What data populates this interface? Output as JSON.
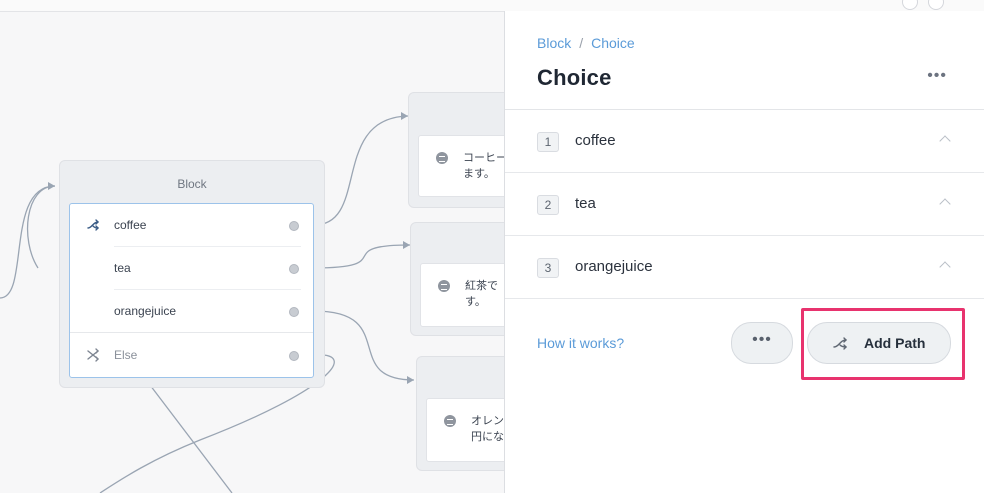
{
  "canvas": {
    "block": {
      "title": "Block",
      "choices": [
        {
          "label": "coffee",
          "icon": "shuffle-path-icon"
        },
        {
          "label": "tea",
          "icon": ""
        },
        {
          "label": "orangejuice",
          "icon": ""
        },
        {
          "label": "Else",
          "icon": "shuffle-cross-icon"
        }
      ]
    },
    "messages": [
      {
        "line1": "コーヒー",
        "line2": "ます。"
      },
      {
        "line1": "紅茶で",
        "line2": "す。"
      },
      {
        "line1": "オレン",
        "line2": "円にな"
      }
    ]
  },
  "panel": {
    "breadcrumb": {
      "parent": "Block",
      "separator": "/",
      "current": "Choice"
    },
    "title": "Choice",
    "paths": [
      {
        "number": "1",
        "label": "coffee"
      },
      {
        "number": "2",
        "label": "tea"
      },
      {
        "number": "3",
        "label": "orangejuice"
      }
    ],
    "how_link": "How it works?",
    "more_button": "•••",
    "add_path_button": "Add Path",
    "title_more": "•••"
  },
  "colors": {
    "link": "#5b9bd8",
    "highlight": "#e8336e",
    "selected_border": "#9cc3ea"
  }
}
